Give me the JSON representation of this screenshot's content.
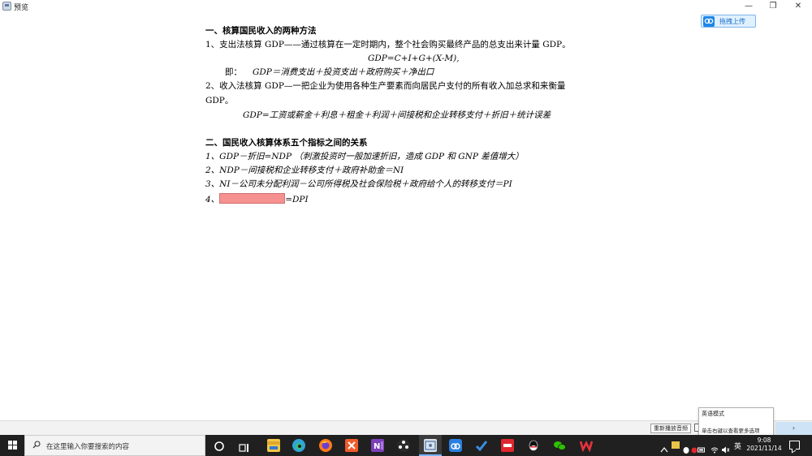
{
  "window": {
    "title": "预览",
    "min_glyph": "—",
    "max_glyph": "❐",
    "close_glyph": "✕"
  },
  "upload": {
    "label": "拖拽上传",
    "icon": "cloud-upload-icon"
  },
  "document": {
    "heading1": "一、核算国民收入的两种方法",
    "item1": "1、支出法核算 GDP——通过核算在一定时期内，整个社会购买最终产品的总支出来计量 GDP。",
    "formula1": "GDP=C+I+G+(X-M),",
    "formula1_prefix": "即：",
    "formula1_detail": "GDP＝消费支出＋投资支出＋政府购买＋净出口",
    "item2_line1": "2、收入法核算 GDP—一把企业为使用各种生产要素而向居民户支付的所有收入加总求和来衡量",
    "item2_line2": "GDP。",
    "formula2": "GDP=工资或薪金＋利息＋租金＋利润＋间接税和企业转移支付＋折旧＋统计误差",
    "heading2": "二、国民收入核算体系五个指标之间的关系",
    "rel1": "1、GDP－折旧=NDP （刺激投资时一般加速折旧，造成 GDP 和 GNP 差值增大）",
    "rel2": "2、NDP－间接税和企业转移支付＋政府补助金＝NI",
    "rel3": "3、NI－公司未分配利润－公司所得税及社会保险税＋政府给个人的转移支付＝PI",
    "rel4_prefix": "4、",
    "rel4_suffix": "=DPI",
    "rel4_blank_color": "#f59191"
  },
  "bottom_bar": {
    "replay_label": "重新播放音频",
    "next_glyph": "›"
  },
  "ime_popup": {
    "mode": "英语模式",
    "hint": "单击右键以查看更多选项"
  },
  "taskbar": {
    "search_placeholder": "在这里输入你要搜索的内容",
    "lang": "英",
    "time": "9:08",
    "date": "2021/11/14",
    "icons": [
      "cortana-icon",
      "task-view-icon",
      "file-explorer-icon",
      "edge-icon",
      "firefox-icon",
      "xmind-icon",
      "onenote-icon",
      "davinci-icon",
      "preview-app-icon",
      "baidu-netdisk-icon",
      "todo-icon",
      "youdao-icon",
      "qq-icon",
      "wechat-icon",
      "wps-icon"
    ]
  },
  "colors": {
    "taskbar": "#202020",
    "upload_accent": "#1e86e6",
    "blank_fill": "#f59191"
  }
}
